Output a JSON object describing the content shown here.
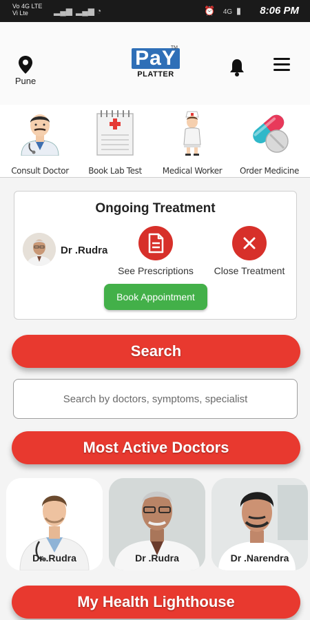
{
  "status_bar": {
    "carrier_line1": "Vo 4G LTE",
    "carrier_line2": "Vi Lte",
    "network": "4G",
    "time": "8:06 PM"
  },
  "header": {
    "location": "Pune",
    "location_icon": "map-pin-icon",
    "logo_pay": "PaY",
    "logo_tm": "TM",
    "logo_platter": "PLATTER",
    "notification_icon": "bell-icon",
    "menu_icon": "hamburger-menu-icon"
  },
  "services": [
    {
      "label": "Consult Doctor",
      "icon": "doctor-icon"
    },
    {
      "label": "Book Lab Test",
      "icon": "clipboard-icon"
    },
    {
      "label": "Medical Worker",
      "icon": "nurse-icon"
    },
    {
      "label": "Order Medicine",
      "icon": "pills-icon"
    }
  ],
  "ongoing_treatment": {
    "title": "Ongoing Treatment",
    "doctor_name": "Dr .Rudra",
    "prescriptions_label": "See Prescriptions",
    "close_label": "Close Treatment",
    "book_label": "Book Appointment"
  },
  "search": {
    "button_label": "Search",
    "placeholder": "Search by doctors, symptoms, specialist"
  },
  "active_doctors": {
    "heading": "Most Active Doctors",
    "doctors": [
      {
        "name": "Dr .Rudra"
      },
      {
        "name": "Dr .Rudra"
      },
      {
        "name": "Dr .Narendra"
      }
    ]
  },
  "lighthouse": {
    "heading": "My Health Lighthouse"
  },
  "colors": {
    "accent_red": "#e8392f",
    "book_green": "#43b049",
    "logo_blue": "#2f6fb7"
  }
}
